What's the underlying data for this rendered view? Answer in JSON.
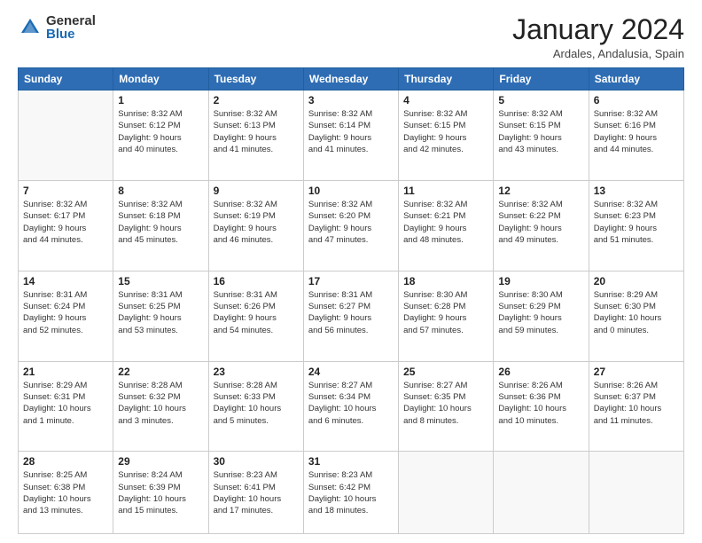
{
  "header": {
    "logo_general": "General",
    "logo_blue": "Blue",
    "month_title": "January 2024",
    "location": "Ardales, Andalusia, Spain"
  },
  "days_of_week": [
    "Sunday",
    "Monday",
    "Tuesday",
    "Wednesday",
    "Thursday",
    "Friday",
    "Saturday"
  ],
  "weeks": [
    [
      {
        "day": "",
        "info": ""
      },
      {
        "day": "1",
        "info": "Sunrise: 8:32 AM\nSunset: 6:12 PM\nDaylight: 9 hours\nand 40 minutes."
      },
      {
        "day": "2",
        "info": "Sunrise: 8:32 AM\nSunset: 6:13 PM\nDaylight: 9 hours\nand 41 minutes."
      },
      {
        "day": "3",
        "info": "Sunrise: 8:32 AM\nSunset: 6:14 PM\nDaylight: 9 hours\nand 41 minutes."
      },
      {
        "day": "4",
        "info": "Sunrise: 8:32 AM\nSunset: 6:15 PM\nDaylight: 9 hours\nand 42 minutes."
      },
      {
        "day": "5",
        "info": "Sunrise: 8:32 AM\nSunset: 6:15 PM\nDaylight: 9 hours\nand 43 minutes."
      },
      {
        "day": "6",
        "info": "Sunrise: 8:32 AM\nSunset: 6:16 PM\nDaylight: 9 hours\nand 44 minutes."
      }
    ],
    [
      {
        "day": "7",
        "info": "Sunrise: 8:32 AM\nSunset: 6:17 PM\nDaylight: 9 hours\nand 44 minutes."
      },
      {
        "day": "8",
        "info": "Sunrise: 8:32 AM\nSunset: 6:18 PM\nDaylight: 9 hours\nand 45 minutes."
      },
      {
        "day": "9",
        "info": "Sunrise: 8:32 AM\nSunset: 6:19 PM\nDaylight: 9 hours\nand 46 minutes."
      },
      {
        "day": "10",
        "info": "Sunrise: 8:32 AM\nSunset: 6:20 PM\nDaylight: 9 hours\nand 47 minutes."
      },
      {
        "day": "11",
        "info": "Sunrise: 8:32 AM\nSunset: 6:21 PM\nDaylight: 9 hours\nand 48 minutes."
      },
      {
        "day": "12",
        "info": "Sunrise: 8:32 AM\nSunset: 6:22 PM\nDaylight: 9 hours\nand 49 minutes."
      },
      {
        "day": "13",
        "info": "Sunrise: 8:32 AM\nSunset: 6:23 PM\nDaylight: 9 hours\nand 51 minutes."
      }
    ],
    [
      {
        "day": "14",
        "info": "Sunrise: 8:31 AM\nSunset: 6:24 PM\nDaylight: 9 hours\nand 52 minutes."
      },
      {
        "day": "15",
        "info": "Sunrise: 8:31 AM\nSunset: 6:25 PM\nDaylight: 9 hours\nand 53 minutes."
      },
      {
        "day": "16",
        "info": "Sunrise: 8:31 AM\nSunset: 6:26 PM\nDaylight: 9 hours\nand 54 minutes."
      },
      {
        "day": "17",
        "info": "Sunrise: 8:31 AM\nSunset: 6:27 PM\nDaylight: 9 hours\nand 56 minutes."
      },
      {
        "day": "18",
        "info": "Sunrise: 8:30 AM\nSunset: 6:28 PM\nDaylight: 9 hours\nand 57 minutes."
      },
      {
        "day": "19",
        "info": "Sunrise: 8:30 AM\nSunset: 6:29 PM\nDaylight: 9 hours\nand 59 minutes."
      },
      {
        "day": "20",
        "info": "Sunrise: 8:29 AM\nSunset: 6:30 PM\nDaylight: 10 hours\nand 0 minutes."
      }
    ],
    [
      {
        "day": "21",
        "info": "Sunrise: 8:29 AM\nSunset: 6:31 PM\nDaylight: 10 hours\nand 1 minute."
      },
      {
        "day": "22",
        "info": "Sunrise: 8:28 AM\nSunset: 6:32 PM\nDaylight: 10 hours\nand 3 minutes."
      },
      {
        "day": "23",
        "info": "Sunrise: 8:28 AM\nSunset: 6:33 PM\nDaylight: 10 hours\nand 5 minutes."
      },
      {
        "day": "24",
        "info": "Sunrise: 8:27 AM\nSunset: 6:34 PM\nDaylight: 10 hours\nand 6 minutes."
      },
      {
        "day": "25",
        "info": "Sunrise: 8:27 AM\nSunset: 6:35 PM\nDaylight: 10 hours\nand 8 minutes."
      },
      {
        "day": "26",
        "info": "Sunrise: 8:26 AM\nSunset: 6:36 PM\nDaylight: 10 hours\nand 10 minutes."
      },
      {
        "day": "27",
        "info": "Sunrise: 8:26 AM\nSunset: 6:37 PM\nDaylight: 10 hours\nand 11 minutes."
      }
    ],
    [
      {
        "day": "28",
        "info": "Sunrise: 8:25 AM\nSunset: 6:38 PM\nDaylight: 10 hours\nand 13 minutes."
      },
      {
        "day": "29",
        "info": "Sunrise: 8:24 AM\nSunset: 6:39 PM\nDaylight: 10 hours\nand 15 minutes."
      },
      {
        "day": "30",
        "info": "Sunrise: 8:23 AM\nSunset: 6:41 PM\nDaylight: 10 hours\nand 17 minutes."
      },
      {
        "day": "31",
        "info": "Sunrise: 8:23 AM\nSunset: 6:42 PM\nDaylight: 10 hours\nand 18 minutes."
      },
      {
        "day": "",
        "info": ""
      },
      {
        "day": "",
        "info": ""
      },
      {
        "day": "",
        "info": ""
      }
    ]
  ]
}
